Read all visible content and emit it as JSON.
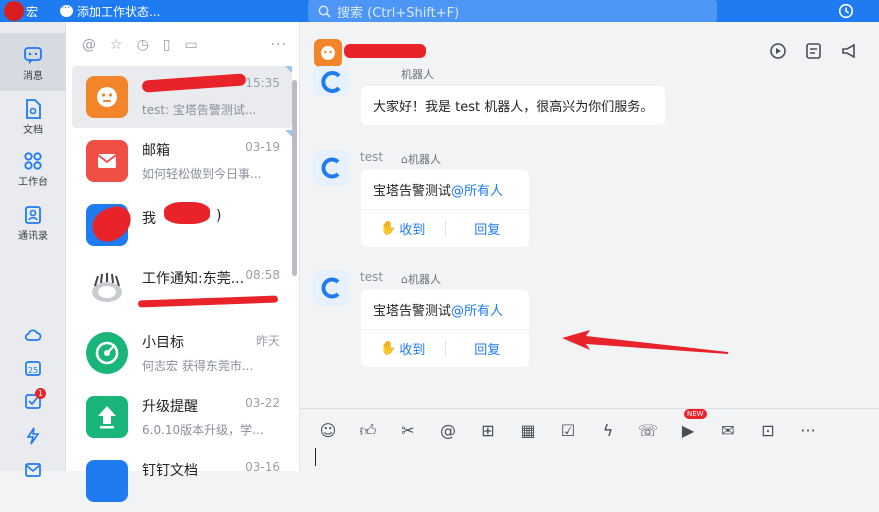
{
  "topbar": {
    "user_name": "宏",
    "status_label": "添加工作状态...",
    "search_placeholder": "搜索 (Ctrl+Shift+F)"
  },
  "rail": {
    "items": [
      {
        "label": "消息",
        "icon": "message-icon"
      },
      {
        "label": "文档",
        "icon": "document-icon"
      },
      {
        "label": "工作台",
        "icon": "workbench-icon"
      },
      {
        "label": "通讯录",
        "icon": "contacts-icon"
      }
    ],
    "bottom_badge": "1"
  },
  "conversations": [
    {
      "title": "",
      "time": "15:35",
      "subtitle": "test: 宝塔告警测试...",
      "color": "#f2842a"
    },
    {
      "title": "邮箱",
      "time": "03-19",
      "subtitle": "如何轻松做到今日事...",
      "color": "#f04f45"
    },
    {
      "title": "我",
      "title_suffix": ")",
      "time": "",
      "subtitle": "",
      "color": "#1e7bf2"
    },
    {
      "title": "工作通知:东莞...",
      "time": "08:58",
      "subtitle": "",
      "color": "#ffffff"
    },
    {
      "title": "小目标",
      "time": "昨天",
      "subtitle": "何志宏 获得东莞市...",
      "color": "#19b57a"
    },
    {
      "title": "升级提醒",
      "time": "03-22",
      "subtitle": "6.0.10版本升级，学...",
      "color": "#19b57a"
    },
    {
      "title": "钉钉文档",
      "time": "03-16",
      "subtitle": "",
      "color": "#1e7bf2"
    }
  ],
  "chat": {
    "messages": [
      {
        "name": "",
        "tag": "机器人",
        "text": "大家好！我是 test 机器人，很高兴为你们服务。"
      },
      {
        "name": "test",
        "tag": "机器人",
        "text": "宝塔告警测试",
        "mention": "@所有人",
        "ack": "收到",
        "reply": "回复"
      },
      {
        "name": "test",
        "tag": "机器人",
        "text": "宝塔告警测试",
        "mention": "@所有人",
        "ack": "收到",
        "reply": "回复"
      }
    ]
  },
  "toolbar": {
    "new_badge": "NEW"
  }
}
